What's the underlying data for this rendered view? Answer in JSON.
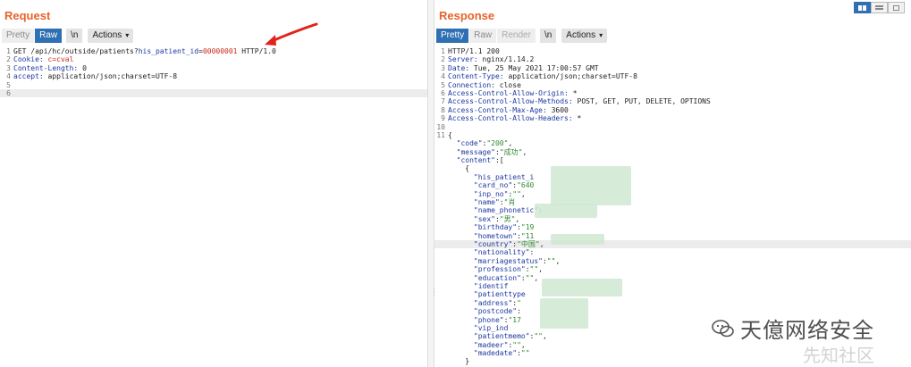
{
  "request": {
    "title": "Request",
    "tabs": [
      "Pretty",
      "Raw",
      "\\n"
    ],
    "actions_label": "Actions",
    "lines": [
      {
        "n": "1",
        "parts": [
          {
            "t": "GET /api/hc/outside/patients?",
            "c": "plain"
          },
          {
            "t": "his_patient_id",
            "c": "key"
          },
          {
            "t": "=",
            "c": "plain"
          },
          {
            "t": "00000001",
            "c": "val"
          },
          {
            "t": " HTTP/1.0",
            "c": "plain"
          }
        ]
      },
      {
        "n": "2",
        "parts": [
          {
            "t": "Cookie: ",
            "c": "key"
          },
          {
            "t": "c=cval",
            "c": "val"
          }
        ]
      },
      {
        "n": "3",
        "parts": [
          {
            "t": "Content-Length: ",
            "c": "key"
          },
          {
            "t": "0",
            "c": "plain"
          }
        ]
      },
      {
        "n": "4",
        "parts": [
          {
            "t": "accept: ",
            "c": "key"
          },
          {
            "t": "application/json;charset=UTF-8",
            "c": "plain"
          }
        ]
      },
      {
        "n": "5",
        "parts": []
      },
      {
        "n": "6",
        "parts": [],
        "highlight": true
      }
    ]
  },
  "response": {
    "title": "Response",
    "tabs": [
      "Pretty",
      "Raw",
      "Render",
      "\\n"
    ],
    "actions_label": "Actions",
    "lines": [
      {
        "n": "1",
        "parts": [
          {
            "t": "HTTP/1.1 200",
            "c": "plain"
          }
        ]
      },
      {
        "n": "2",
        "parts": [
          {
            "t": "Server: ",
            "c": "key"
          },
          {
            "t": "nginx/1.14.2",
            "c": "plain"
          }
        ]
      },
      {
        "n": "3",
        "parts": [
          {
            "t": "Date: ",
            "c": "key"
          },
          {
            "t": "Tue, 25 May 2021 17:00:57 GMT",
            "c": "plain"
          }
        ]
      },
      {
        "n": "4",
        "parts": [
          {
            "t": "Content-Type: ",
            "c": "key"
          },
          {
            "t": "application/json;charset=UTF-8",
            "c": "plain"
          }
        ]
      },
      {
        "n": "5",
        "parts": [
          {
            "t": "Connection: ",
            "c": "key"
          },
          {
            "t": "close",
            "c": "plain"
          }
        ]
      },
      {
        "n": "6",
        "parts": [
          {
            "t": "Access-Control-Allow-Origin: ",
            "c": "key"
          },
          {
            "t": "*",
            "c": "plain"
          }
        ]
      },
      {
        "n": "7",
        "parts": [
          {
            "t": "Access-Control-Allow-Methods: ",
            "c": "key"
          },
          {
            "t": "POST, GET, PUT, DELETE, OPTIONS",
            "c": "plain"
          }
        ]
      },
      {
        "n": "8",
        "parts": [
          {
            "t": "Access-Control-Max-Age: ",
            "c": "key"
          },
          {
            "t": "3600",
            "c": "plain"
          }
        ]
      },
      {
        "n": "9",
        "parts": [
          {
            "t": "Access-Control-Allow-Headers: ",
            "c": "key"
          },
          {
            "t": "*",
            "c": "plain"
          }
        ]
      },
      {
        "n": "10",
        "parts": []
      },
      {
        "n": "11",
        "parts": [
          {
            "t": "{",
            "c": "plain"
          }
        ]
      },
      {
        "n": "",
        "parts": [
          {
            "t": "  \"code\"",
            "c": "key"
          },
          {
            "t": ":",
            "c": "plain"
          },
          {
            "t": "\"200\"",
            "c": "str"
          },
          {
            "t": ",",
            "c": "plain"
          }
        ]
      },
      {
        "n": "",
        "parts": [
          {
            "t": "  \"message\"",
            "c": "key"
          },
          {
            "t": ":",
            "c": "plain"
          },
          {
            "t": "\"成功\"",
            "c": "str"
          },
          {
            "t": ",",
            "c": "plain"
          }
        ]
      },
      {
        "n": "",
        "parts": [
          {
            "t": "  \"content\"",
            "c": "key"
          },
          {
            "t": ":[",
            "c": "plain"
          }
        ]
      },
      {
        "n": "",
        "parts": [
          {
            "t": "    {",
            "c": "plain"
          }
        ]
      },
      {
        "n": "",
        "parts": [
          {
            "t": "      \"his_patient_i",
            "c": "key"
          }
        ]
      },
      {
        "n": "",
        "parts": [
          {
            "t": "      \"card_no\"",
            "c": "key"
          },
          {
            "t": ":",
            "c": "plain"
          },
          {
            "t": "\"640",
            "c": "str"
          }
        ]
      },
      {
        "n": "",
        "parts": [
          {
            "t": "      \"inp_no\"",
            "c": "key"
          },
          {
            "t": ":",
            "c": "plain"
          },
          {
            "t": "\"\"",
            "c": "str"
          },
          {
            "t": ",",
            "c": "plain"
          }
        ]
      },
      {
        "n": "",
        "parts": [
          {
            "t": "      \"name\"",
            "c": "key"
          },
          {
            "t": ":",
            "c": "plain"
          },
          {
            "t": "\"肖",
            "c": "str"
          }
        ]
      },
      {
        "n": "",
        "parts": [
          {
            "t": "      \"name_phonetic\"",
            "c": "key"
          },
          {
            "t": ":",
            "c": "plain"
          }
        ]
      },
      {
        "n": "",
        "parts": [
          {
            "t": "      \"sex\"",
            "c": "key"
          },
          {
            "t": ":",
            "c": "plain"
          },
          {
            "t": "\"男\"",
            "c": "str"
          },
          {
            "t": ",",
            "c": "plain"
          }
        ]
      },
      {
        "n": "",
        "parts": [
          {
            "t": "      \"birthday\"",
            "c": "key"
          },
          {
            "t": ":",
            "c": "plain"
          },
          {
            "t": "\"19",
            "c": "str"
          }
        ]
      },
      {
        "n": "",
        "parts": [
          {
            "t": "      \"hometown\"",
            "c": "key"
          },
          {
            "t": ":",
            "c": "plain"
          },
          {
            "t": "\"11",
            "c": "str"
          }
        ]
      },
      {
        "n": "",
        "parts": [
          {
            "t": "      \"country\"",
            "c": "key"
          },
          {
            "t": ":",
            "c": "plain"
          },
          {
            "t": "\"中国\"",
            "c": "str"
          },
          {
            "t": ",",
            "c": "plain"
          }
        ],
        "highlight": true
      },
      {
        "n": "",
        "parts": [
          {
            "t": "      \"nationality\"",
            "c": "key"
          },
          {
            "t": ":",
            "c": "plain"
          }
        ]
      },
      {
        "n": "",
        "parts": [
          {
            "t": "      \"marriagestatus\"",
            "c": "key"
          },
          {
            "t": ":",
            "c": "plain"
          },
          {
            "t": "\"\"",
            "c": "str"
          },
          {
            "t": ",",
            "c": "plain"
          }
        ]
      },
      {
        "n": "",
        "parts": [
          {
            "t": "      \"profession\"",
            "c": "key"
          },
          {
            "t": ":",
            "c": "plain"
          },
          {
            "t": "\"\"",
            "c": "str"
          },
          {
            "t": ",",
            "c": "plain"
          }
        ]
      },
      {
        "n": "",
        "parts": [
          {
            "t": "      \"education\"",
            "c": "key"
          },
          {
            "t": ":",
            "c": "plain"
          },
          {
            "t": "\"\"",
            "c": "str"
          },
          {
            "t": ",",
            "c": "plain"
          }
        ]
      },
      {
        "n": "",
        "parts": [
          {
            "t": "      \"identif",
            "c": "key"
          }
        ]
      },
      {
        "n": "",
        "parts": [
          {
            "t": "      \"patienttype",
            "c": "key"
          }
        ]
      },
      {
        "n": "",
        "parts": [
          {
            "t": "      \"address\"",
            "c": "key"
          },
          {
            "t": ":",
            "c": "plain"
          },
          {
            "t": "\"",
            "c": "str"
          }
        ]
      },
      {
        "n": "",
        "parts": [
          {
            "t": "      \"postcode\"",
            "c": "key"
          },
          {
            "t": ":",
            "c": "plain"
          }
        ]
      },
      {
        "n": "",
        "parts": [
          {
            "t": "      \"phone\"",
            "c": "key"
          },
          {
            "t": ":",
            "c": "plain"
          },
          {
            "t": "\"17",
            "c": "str"
          }
        ]
      },
      {
        "n": "",
        "parts": [
          {
            "t": "      \"vip_ind",
            "c": "key"
          }
        ]
      },
      {
        "n": "",
        "parts": [
          {
            "t": "      \"patientmemo\"",
            "c": "key"
          },
          {
            "t": ":",
            "c": "plain"
          },
          {
            "t": "\"\"",
            "c": "str"
          },
          {
            "t": ",",
            "c": "plain"
          }
        ]
      },
      {
        "n": "",
        "parts": [
          {
            "t": "      \"madeer\"",
            "c": "key"
          },
          {
            "t": ":",
            "c": "plain"
          },
          {
            "t": "\"\"",
            "c": "str"
          },
          {
            "t": ",",
            "c": "plain"
          }
        ]
      },
      {
        "n": "",
        "parts": [
          {
            "t": "      \"madedate\"",
            "c": "key"
          },
          {
            "t": ":",
            "c": "plain"
          },
          {
            "t": "\"\"",
            "c": "str"
          }
        ]
      },
      {
        "n": "",
        "parts": [
          {
            "t": "    }",
            "c": "plain"
          }
        ]
      }
    ]
  },
  "watermark": {
    "text": "天億网络安全",
    "sub": "先知社区"
  },
  "colors": {
    "accent": "#e8632b",
    "tab_active": "#2f6fb3",
    "key": "#1d38a0",
    "value": "#c8291c",
    "string": "#2f8a2f"
  },
  "icons": {
    "layout_split": "split-columns-icon",
    "layout_rows": "split-rows-icon",
    "layout_single": "single-pane-icon",
    "chevron": "chevron-down-icon",
    "annotation": "red-arrow-icon",
    "wechat": "wechat-icon"
  }
}
